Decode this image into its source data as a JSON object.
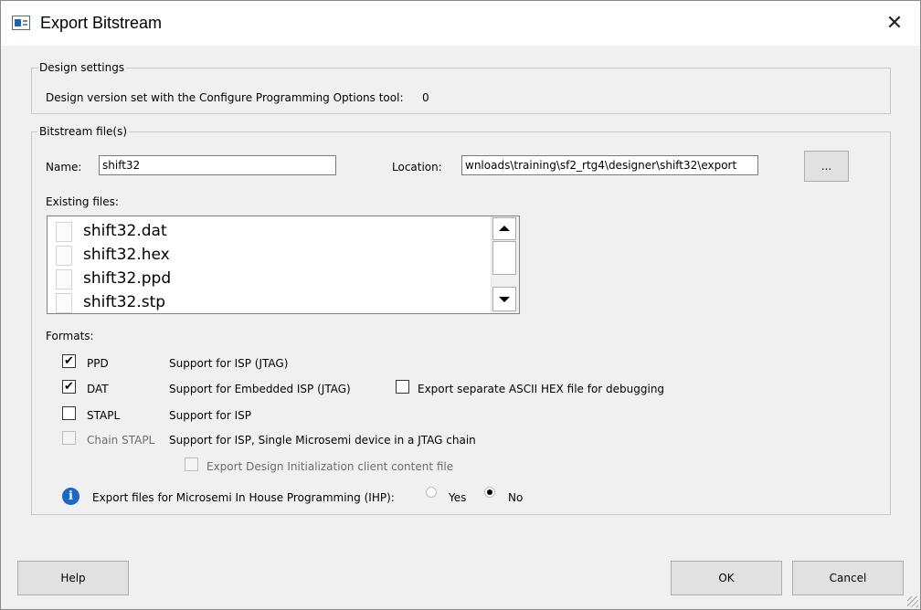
{
  "window": {
    "title": "Export Bitstream",
    "close_glyph": "✕"
  },
  "design_settings": {
    "legend": "Design settings",
    "version_text": "Design version set with the Configure Programming Options tool:",
    "version_value": "0"
  },
  "bitstream": {
    "legend": "Bitstream file(s)",
    "name_label": "Name:",
    "name_value": "shift32",
    "location_label": "Location:",
    "location_value": "wnloads\\training\\sf2_rtg4\\designer\\shift32\\export",
    "browse_label": "...",
    "existing_label": "Existing files:",
    "existing_files": [
      "shift32.dat",
      "shift32.hex",
      "shift32.ppd",
      "shift32.stp"
    ],
    "formats_label": "Formats:",
    "formats": {
      "ppd": {
        "label": "PPD",
        "desc": "Support for ISP (JTAG)",
        "checked": true
      },
      "dat": {
        "label": "DAT",
        "desc": "Support for Embedded ISP (JTAG)",
        "checked": true
      },
      "hex_debug": {
        "label": "Export separate ASCII HEX file for debugging",
        "checked": false
      },
      "stapl": {
        "label": "STAPL",
        "desc": "Support for ISP",
        "checked": false
      },
      "chain_stapl": {
        "label": "Chain STAPL",
        "desc": "Support for ISP,  Single Microsemi device in a JTAG chain",
        "checked": false,
        "disabled": true
      },
      "design_init": {
        "label": "Export Design Initialization client content file",
        "checked": false,
        "disabled": true
      }
    },
    "ihp": {
      "label": "Export files for Microsemi In House Programming (IHP):",
      "yes_label": "Yes",
      "no_label": "No",
      "selected": "No",
      "info_icon_glyph": "i"
    }
  },
  "buttons": {
    "help": "Help",
    "ok": "OK",
    "cancel": "Cancel"
  },
  "icons": {
    "app": "export-bitstream-app-icon",
    "close": "close-icon",
    "file": "file-icon",
    "info": "info-icon",
    "scroll_up": "scroll-up-arrow-icon",
    "scroll_down": "scroll-down-arrow-icon",
    "check": "checkmark-icon"
  },
  "colors": {
    "title_bar": "#ffffff",
    "dialog_bg": "#f0f0f0",
    "info_blue": "#1a68c6"
  }
}
